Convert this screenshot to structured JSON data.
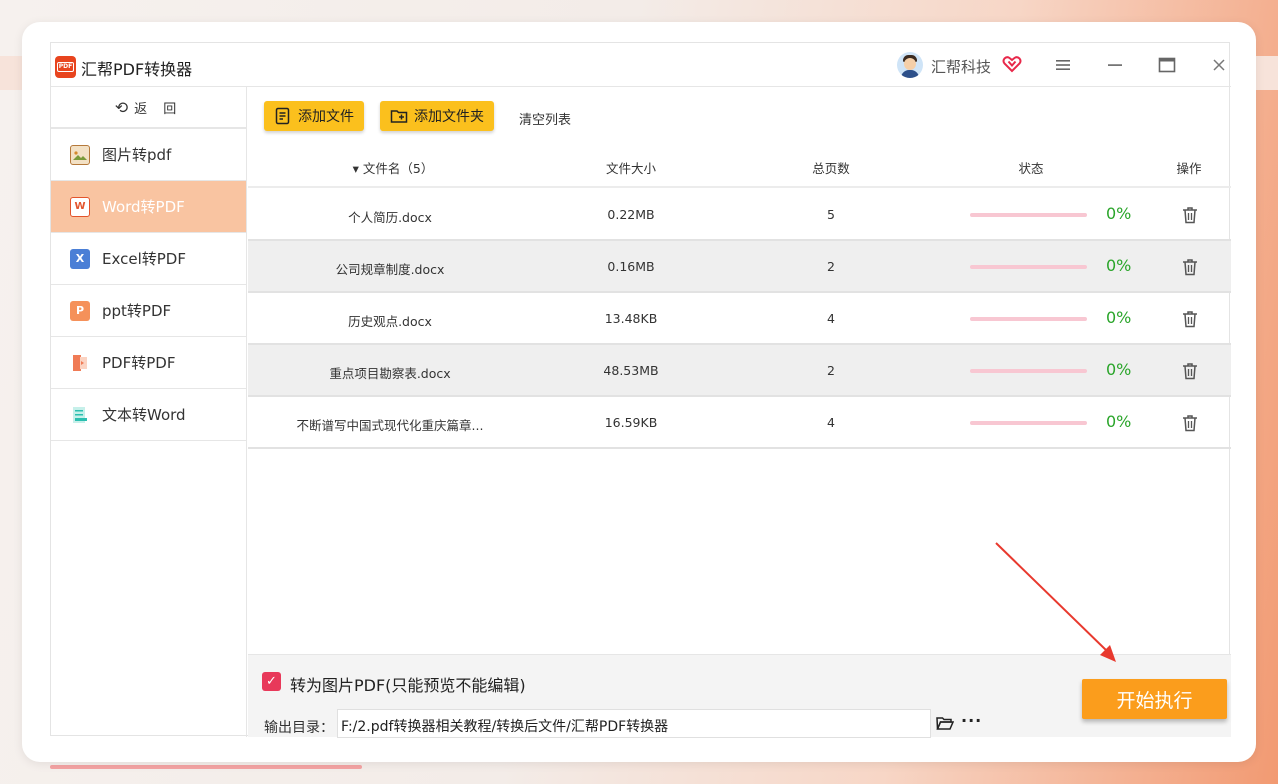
{
  "app": {
    "title": "汇帮PDF转换器",
    "logo_text": "PDF",
    "company": "汇帮科技"
  },
  "sidebar": {
    "back_label": "返 回",
    "items": [
      {
        "label": "图片转pdf",
        "icon": "image-icon"
      },
      {
        "label": "Word转PDF",
        "icon": "word-icon",
        "active": true
      },
      {
        "label": "Excel转PDF",
        "icon": "excel-icon",
        "icon_text": "X"
      },
      {
        "label": "ppt转PDF",
        "icon": "ppt-icon",
        "icon_text": "P"
      },
      {
        "label": "PDF转PDF",
        "icon": "pdf-icon"
      },
      {
        "label": "文本转Word",
        "icon": "text-icon"
      }
    ]
  },
  "toolbar": {
    "add_file": "添加文件",
    "add_folder": "添加文件夹",
    "clear_list": "清空列表"
  },
  "table": {
    "headers": {
      "name": "▾ 文件名（5）",
      "size": "文件大小",
      "pages": "总页数",
      "status": "状态",
      "action": "操作"
    },
    "rows": [
      {
        "name": "个人简历.docx",
        "size": "0.22MB",
        "pages": "5",
        "progress": 0,
        "percent": "0%"
      },
      {
        "name": "公司规章制度.docx",
        "size": "0.16MB",
        "pages": "2",
        "progress": 0,
        "percent": "0%"
      },
      {
        "name": "历史观点.docx",
        "size": "13.48KB",
        "pages": "4",
        "progress": 0,
        "percent": "0%"
      },
      {
        "name": "重点项目勘察表.docx",
        "size": "48.53MB",
        "pages": "2",
        "progress": 0,
        "percent": "0%"
      },
      {
        "name": "不断谱写中国式现代化重庆篇章...",
        "size": "16.59KB",
        "pages": "4",
        "progress": 0,
        "percent": "0%"
      }
    ]
  },
  "bottom": {
    "checkbox_label": "转为图片PDF(只能预览不能编辑)",
    "checkbox_checked": true,
    "output_label": "输出目录：",
    "output_path": "F:/2.pdf转换器相关教程/转换后文件/汇帮PDF转换器",
    "more_label": "···",
    "start_button": "开始执行"
  },
  "colors": {
    "accent_yellow": "#fbc01d",
    "start_orange": "#fb9d1c",
    "active_nav": "#f9c4a1",
    "progress_green": "#2aa52a",
    "arrow_red": "#e8392e"
  }
}
